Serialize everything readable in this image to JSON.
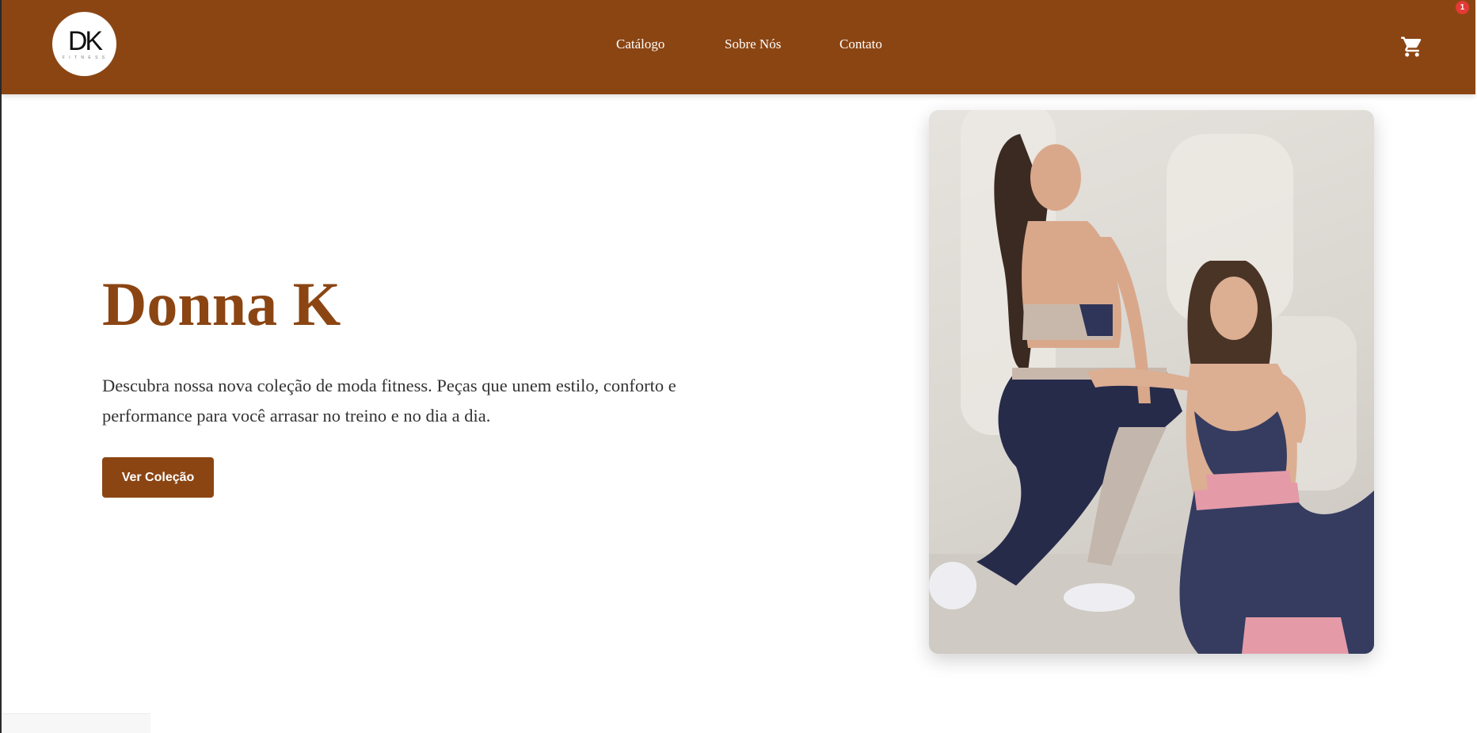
{
  "header": {
    "logo": {
      "text": "DK",
      "subtitle": "F I T N E S S"
    },
    "nav": [
      {
        "label": "Catálogo"
      },
      {
        "label": "Sobre Nós"
      },
      {
        "label": "Contato"
      }
    ],
    "cart": {
      "icon": "shopping-cart-icon",
      "badge_count": "1"
    }
  },
  "hero": {
    "title": "Donna K",
    "description": "Descubra nossa nova coleção de moda fitness. Peças que unem estilo, conforto e performance para você arrasar no treino e no dia a dia.",
    "cta_label": "Ver Coleção",
    "image": "two-women-fitness-wear-photo"
  },
  "colors": {
    "brand": "#8b4513",
    "text": "#333333",
    "badge": "#e53935",
    "background": "#ffffff"
  }
}
